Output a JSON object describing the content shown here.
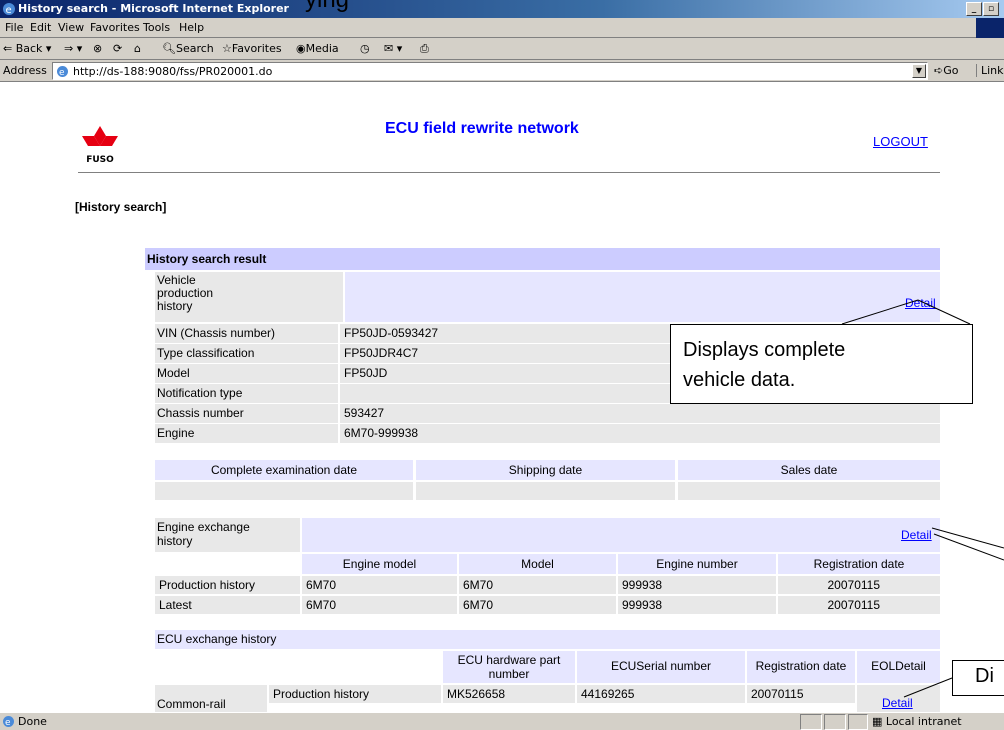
{
  "overlay_text": "ying",
  "window": {
    "title": "History search - Microsoft Internet Explorer"
  },
  "menu": {
    "items": [
      "File",
      "Edit",
      "View",
      "Favorites",
      "Tools",
      "Help"
    ]
  },
  "toolbar": {
    "back": "Back",
    "search": "Search",
    "favorites": "Favorites",
    "media": "Media"
  },
  "address": {
    "label": "Address",
    "url": "http://ds-188:9080/fss/PR020001.do",
    "go": "Go",
    "links": "Links"
  },
  "page": {
    "brand": "FUSO",
    "site_title": "ECU field rewrite network",
    "logout": "LOGOUT",
    "section_title": "[History search]"
  },
  "result": {
    "header": "History search result",
    "vehicle_history_label": "Vehicle production history",
    "detail": "Detail",
    "rows": [
      {
        "label": "VIN (Chassis number)",
        "value": "FP50JD-0593427"
      },
      {
        "label": "Type classification",
        "value": "FP50JDR4C7"
      },
      {
        "label": "Model",
        "value": "FP50JD"
      },
      {
        "label": "Notification type",
        "value": ""
      },
      {
        "label": "Chassis number",
        "value": "593427"
      },
      {
        "label": "Engine",
        "value": "6M70-999938"
      }
    ]
  },
  "dates": {
    "headers": [
      "Complete examination date",
      "Shipping date",
      "Sales date"
    ]
  },
  "engine_exchange": {
    "label": "Engine exchange history",
    "detail": "Detail",
    "columns": [
      "Engine model",
      "Model",
      "Engine number",
      "Registration date"
    ],
    "rows": [
      {
        "label": "Production history",
        "cells": [
          "6M70",
          "6M70",
          "999938",
          "20070115"
        ]
      },
      {
        "label": "Latest",
        "cells": [
          "6M70",
          "6M70",
          "999938",
          "20070115"
        ]
      }
    ]
  },
  "ecu_exchange": {
    "label": "ECU exchange history",
    "columns": [
      "ECU hardware part number",
      "ECUSerial number",
      "Registration date",
      "EOLDetail"
    ],
    "group": "Common-rail",
    "rows": [
      {
        "label": "Production history",
        "cells": [
          "MK526658",
          "44169265",
          "20070115"
        ]
      }
    ],
    "detail": "Detail"
  },
  "callouts": {
    "vehicle": "Displays complete vehicle data.",
    "partial": "Di"
  },
  "status": {
    "text": "Done",
    "zone": "Local intranet"
  }
}
